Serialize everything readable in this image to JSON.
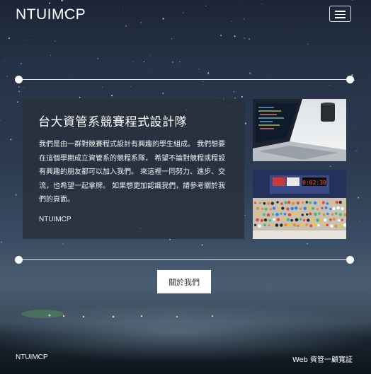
{
  "navbar": {
    "brand": "NTUIMCP",
    "menu_icon": "hamburger-menu-icon"
  },
  "card": {
    "title": "台大資管系競賽程式設計隊",
    "description": "我們是由一群對競賽程式設計有興趣的學生組成。 我們想要在這個學期成立資管系的競程系隊， 希望不論對競程或程設有興趣的朋友都可以加入我們。 來這裡一同努力、進步、交流，也希望一起拿牌。 如果想更加認識我們，請參考關於我們的頁面。",
    "signature": "NTUIMCP"
  },
  "photos": {
    "laptop_alt": "laptop-photo",
    "contest_alt": "contest-hall-photo",
    "scoreboard_time": "0:02:30"
  },
  "about_button": "關於我們",
  "footer": {
    "left": "NTUIMCP",
    "right": "Web 資管一顧寬証"
  }
}
